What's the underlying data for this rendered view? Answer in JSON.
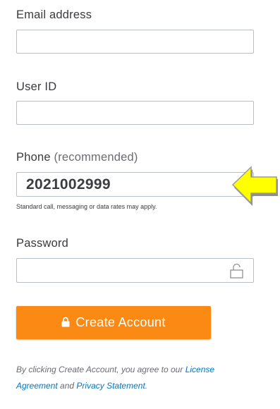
{
  "email": {
    "label": "Email address",
    "value": ""
  },
  "userid": {
    "label": "User ID",
    "value": ""
  },
  "phone": {
    "label": "Phone",
    "label_suffix": "(recommended)",
    "value": "2021002999",
    "hint": "Standard call, messaging or data rates may apply."
  },
  "password": {
    "label": "Password",
    "value": ""
  },
  "create_button": {
    "label": "Create Account",
    "color": "#fb8a14"
  },
  "legal": {
    "prefix": "By clicking Create Account, you agree to our ",
    "license_link": "License Agreement",
    "middle": " and ",
    "privacy_link": "Privacy Statement",
    "suffix": ".",
    "link_color": "#0077c5"
  },
  "icons": {
    "password_toggle": "lock-open-icon",
    "button_lock": "lock-icon",
    "pointer_arrow": "arrow-left-icon"
  },
  "colors": {
    "arrow_fill": "#ffff00",
    "arrow_shadow": "#8f8f8f"
  }
}
